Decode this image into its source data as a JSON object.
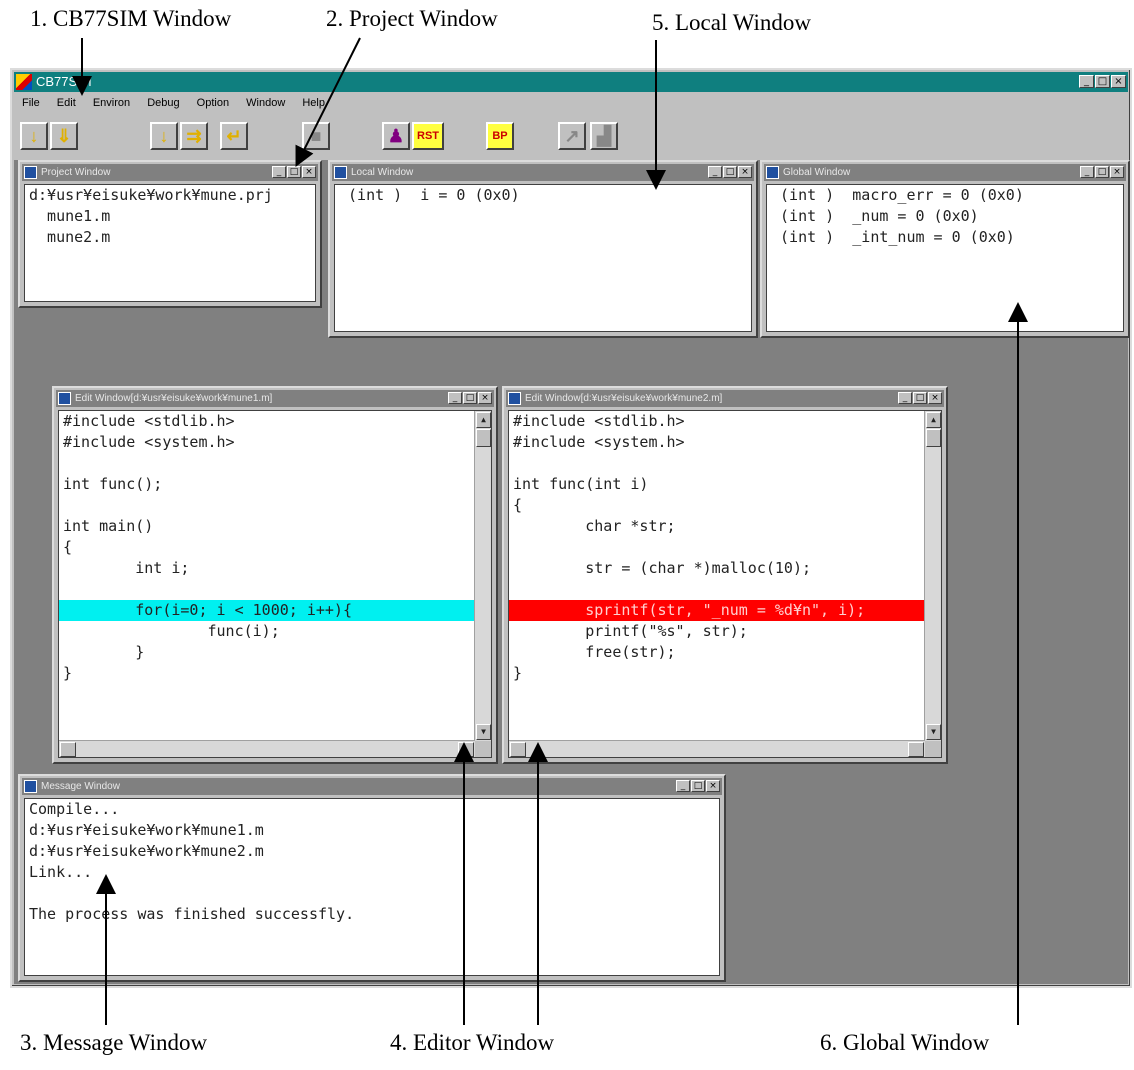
{
  "callouts": {
    "cb77sim": "1. CB77SIM Window",
    "project": "2. Project Window",
    "local": "5. Local Window",
    "message": "3. Message Window",
    "editor": "4. Editor Window",
    "global": "6. Global Window"
  },
  "app": {
    "title": "CB77SIM",
    "menu": [
      "File",
      "Edit",
      "Environ",
      "Debug",
      "Option",
      "Window",
      "Help"
    ],
    "toolbar": {
      "rst_label": "RST",
      "bp_label": "BP"
    }
  },
  "project_window": {
    "title": "Project Window",
    "lines": [
      "d:¥usr¥eisuke¥work¥mune.prj",
      "  mune1.m",
      "  mune2.m"
    ]
  },
  "local_window": {
    "title": "Local Window",
    "lines": [
      " (int )  i = 0 (0x0)"
    ]
  },
  "global_window": {
    "title": "Global Window",
    "lines": [
      " (int )  macro_err = 0 (0x0)",
      " (int )  _num = 0 (0x0)",
      " (int )  _int_num = 0 (0x0)"
    ]
  },
  "edit_window_1": {
    "title": "Edit Window[d:¥usr¥eisuke¥work¥mune1.m]",
    "lines": [
      "#include <stdlib.h>",
      "#include <system.h>",
      "",
      "int func();",
      "",
      "int main()",
      "{",
      "        int i;",
      "",
      "        for(i=0; i < 1000; i++){",
      "                func(i);",
      "        }",
      "}"
    ],
    "highlight_line": 9,
    "highlight_color": "#00f0f0"
  },
  "edit_window_2": {
    "title": "Edit Window[d:¥usr¥eisuke¥work¥mune2.m]",
    "lines": [
      "#include <stdlib.h>",
      "#include <system.h>",
      "",
      "int func(int i)",
      "{",
      "        char *str;",
      "",
      "        str = (char *)malloc(10);",
      "",
      "        sprintf(str, \"_num = %d¥n\", i);",
      "        printf(\"%s\", str);",
      "        free(str);",
      "}"
    ],
    "highlight_line": 9,
    "highlight_color": "#ff0000"
  },
  "message_window": {
    "title": "Message Window",
    "lines": [
      "Compile...",
      "d:¥usr¥eisuke¥work¥mune1.m",
      "d:¥usr¥eisuke¥work¥mune2.m",
      "Link...",
      "",
      "The process was finished successfly."
    ]
  },
  "colors": {
    "app_titlebar": "#0f7f7f",
    "workspace": "#808080",
    "inactive_title": "#808080"
  }
}
